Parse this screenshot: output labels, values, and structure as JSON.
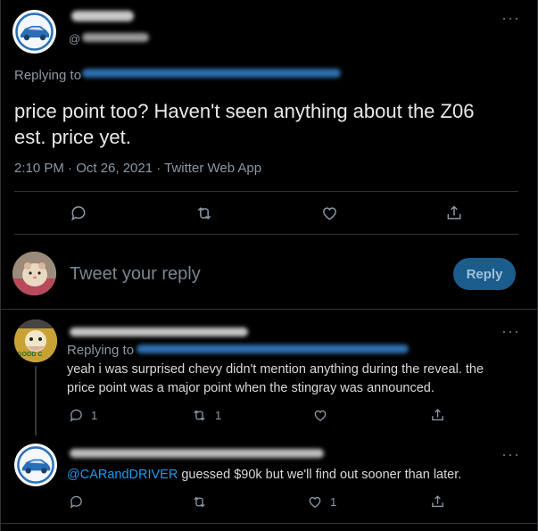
{
  "main_tweet": {
    "author_name": "",
    "author_handle": "@",
    "replying_label": "Replying to",
    "text_line1": "price point too? Haven't seen anything about the Z06",
    "text_line2": "est. price yet.",
    "timestamp": "2:10 PM · Oct 26, 2021 · Twitter Web App"
  },
  "composer": {
    "placeholder": "Tweet your reply",
    "reply_button": "Reply"
  },
  "reply1": {
    "replying_label": "Replying to",
    "text_line1": "yeah i was surprised chevy didn't mention anything during the reveal. the",
    "text_line2": "price point was a major point when the stingray was announced.",
    "reply_count": "1",
    "retweet_count": "1",
    "like_count": "",
    "avatar_text": "GOOD C"
  },
  "reply2": {
    "mention": "@CARandDRIVER",
    "text": " guessed $90k but we'll find out sooner than later.",
    "reply_count": "",
    "retweet_count": "",
    "like_count": "1"
  },
  "colors": {
    "accent": "#1d9bf0",
    "reply_button_bg": "#1a5d8c",
    "divider": "#2f3336",
    "muted": "#8b98a5"
  },
  "icons": [
    "reply-icon",
    "retweet-icon",
    "like-icon",
    "share-icon",
    "more-icon",
    "car-logo-icon"
  ]
}
